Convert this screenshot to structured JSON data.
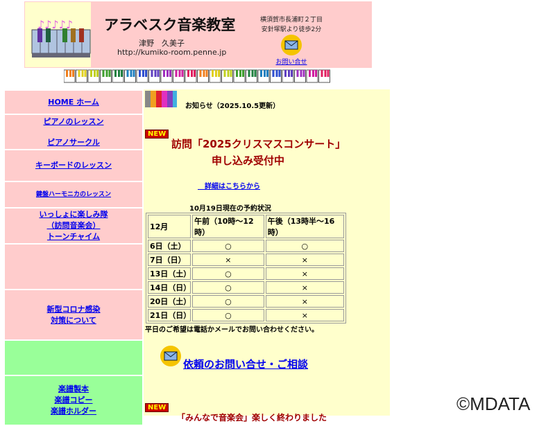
{
  "header": {
    "title": "アラベスク音楽教室",
    "name": "津野　久美子",
    "url": "http://kumiko-room.penne.jp",
    "address_line1": "横須賀市長浦町２丁目",
    "address_line2": "安針塚駅より徒歩2分",
    "contact_link": "お問い合せ"
  },
  "sidebar": {
    "items": [
      {
        "lines": [
          "HOME ホーム"
        ]
      },
      {
        "lines": [
          "ピアノのレッスン",
          "ピアノサークル"
        ]
      },
      {
        "lines": [
          "キーボードのレッスン"
        ]
      },
      {
        "lines": [
          "鍵盤ハーモニカのレッスン"
        ]
      },
      {
        "lines": [
          "いっしょに楽しみ隊",
          "（訪問音楽会）",
          "トーンチャイム"
        ]
      },
      {
        "lines": []
      },
      {
        "lines": [
          "新型コロナ感染",
          "対策について"
        ]
      },
      {
        "lines": []
      },
      {
        "lines": [
          "楽譜製本",
          "楽譜コピー",
          "楽譜ホルダー"
        ]
      }
    ]
  },
  "main": {
    "notice_heading": "お知らせ（2025.10.5更新）",
    "new_badge": "NEW",
    "headline1": "訪問「2025クリスマスコンサート」",
    "headline2": "申し込み受付中",
    "details_link": "　詳細はこちらから",
    "table_caption": "10月19日現在の予約状況",
    "table": {
      "headers": [
        "12月",
        "午前（10時～12時）",
        "午後（13時半～16時）"
      ],
      "rows": [
        [
          "6日（土）",
          "○",
          "○"
        ],
        [
          "7日（日）",
          "×",
          "×"
        ],
        [
          "13日（土）",
          "○",
          "×"
        ],
        [
          "14日（日）",
          "○",
          "×"
        ],
        [
          "20日（土）",
          "○",
          "×"
        ],
        [
          "21日（日）",
          "○",
          "×"
        ]
      ]
    },
    "weekday_note": "平日のご希望は電話かメールでお問い合わせください。",
    "inquiry_link": "依頼のお問い合せ・ご相談",
    "next_item": "「みんなで音楽会」楽しく終わりました"
  },
  "watermark": "©MDATA"
}
